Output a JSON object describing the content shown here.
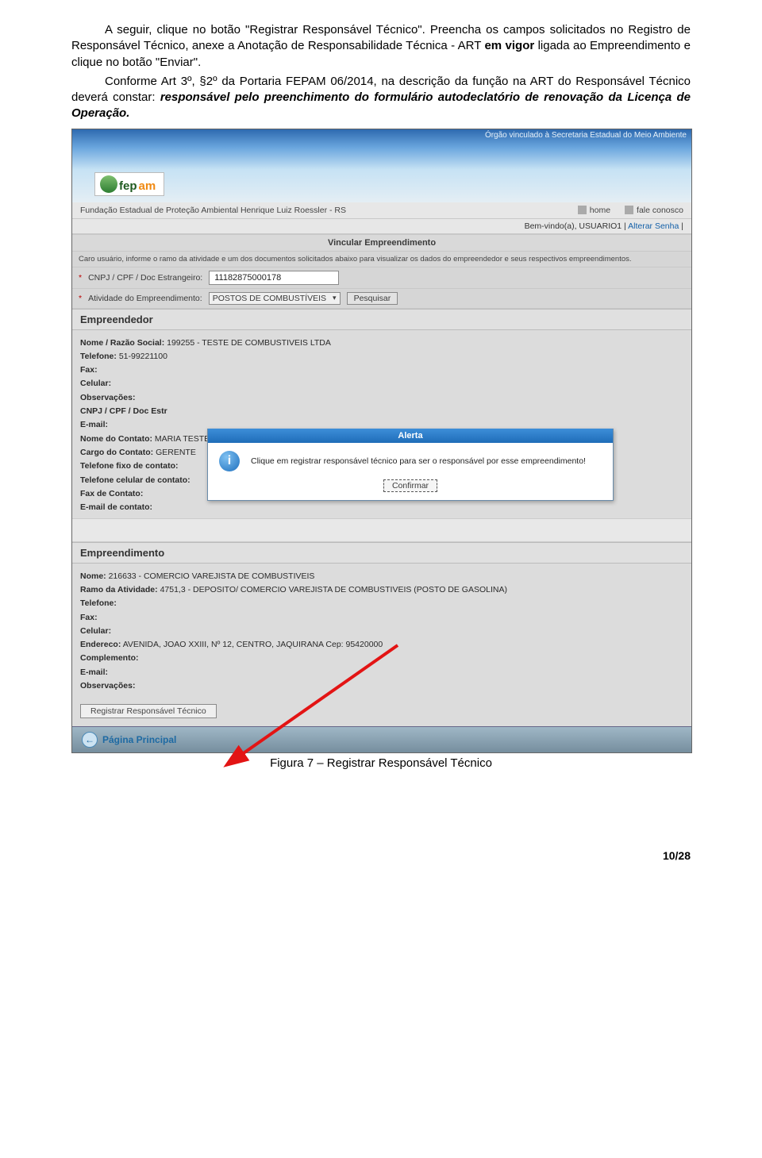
{
  "doc": {
    "p1a": "A seguir, clique no botão \"Registrar Responsável Técnico\". Preencha os campos solicitados no Registro de Responsável Técnico, anexe a Anotação de Responsabilidade Técnica - ART ",
    "p1b": "em vigor",
    "p1c": " ligada ao Empreendimento e clique no botão \"Enviar\".",
    "p2a": "Conforme Art 3º, §2º da Portaria FEPAM 06/2014, na descrição da função na ART do Responsável Técnico deverá constar: ",
    "p2b": "responsável pelo preenchimento do formulário autodeclatório de renovação da Licença de Operação.",
    "caption": "Figura 7 – Registrar Responsável Técnico",
    "pagenum": "10/28"
  },
  "shot": {
    "banner": {
      "org_line": "Órgão vinculado à Secretaria Estadual do Meio Ambiente",
      "logo": {
        "t1": "fep",
        "t2": "am"
      }
    },
    "fundacao": "Fundação Estadual de Proteção Ambiental Henrique Luiz Roessler - RS",
    "nav": {
      "home": "home",
      "fale": "fale conosco"
    },
    "welcome": {
      "text": "Bem-vindo(a), USUARIO1",
      "link": "Alterar Senha"
    },
    "section_title": "Vincular Empreendimento",
    "instrucao": "Caro usuário, informe o ramo da atividade e um dos documentos solicitados abaixo para visualizar os dados do empreendedor e seus respectivos empreendimentos.",
    "form": {
      "cnpj_label": "CNPJ / CPF / Doc Estrangeiro:",
      "cnpj_value": "11182875000178",
      "atividade_label": "Atividade do Empreendimento:",
      "atividade_value": "POSTOS DE COMBUSTÍVEIS",
      "pesquisar": "Pesquisar"
    },
    "empreendedor": {
      "title": "Empreendedor",
      "lines": {
        "nome_l": "Nome / Razão Social:",
        "nome_v": "199255 - TESTE DE COMBUSTIVEIS LTDA",
        "tel_l": "Telefone:",
        "tel_v": "51-99221100",
        "fax_l": "Fax:",
        "cel_l": "Celular:",
        "obs_l": "Observações:",
        "cnpj_l": "CNPJ / CPF / Doc Estr",
        "email_l": "E-mail:",
        "contato_nome_l": "Nome do Contato:",
        "contato_nome_v": "MARIA TESTE",
        "cargo_l": "Cargo do Contato:",
        "cargo_v": "GERENTE",
        "tel_fixo_l": "Telefone fixo de contato:",
        "tel_cel_l": "Telefone celular de contato:",
        "fax_cont_l": "Fax de Contato:",
        "email_cont_l": "E-mail de contato:"
      }
    },
    "empreendimento": {
      "title": "Empreendimento",
      "lines": {
        "nome_l": "Nome:",
        "nome_v": "216633 - COMERCIO VAREJISTA DE COMBUSTIVEIS",
        "ramo_l": "Ramo da Atividade:",
        "ramo_v": "4751,3 - DEPOSITO/ COMERCIO VAREJISTA DE COMBUSTIVEIS (POSTO DE GASOLINA)",
        "tel_l": "Telefone:",
        "fax_l": "Fax:",
        "cel_l": "Celular:",
        "end_l": "Endereco:",
        "end_v": "AVENIDA, JOAO XXIII, Nº 12, CENTRO, JAQUIRANA Cep: 95420000",
        "comp_l": "Complemento:",
        "email_l": "E-mail:",
        "obs_l": "Observações:"
      }
    },
    "reg_btn": "Registrar Responsável Técnico",
    "footer_link": "Página Principal",
    "alert": {
      "title": "Alerta",
      "msg": "Clique em registrar responsável técnico para ser o responsável por esse empreendimento!",
      "btn": "Confirmar"
    }
  }
}
